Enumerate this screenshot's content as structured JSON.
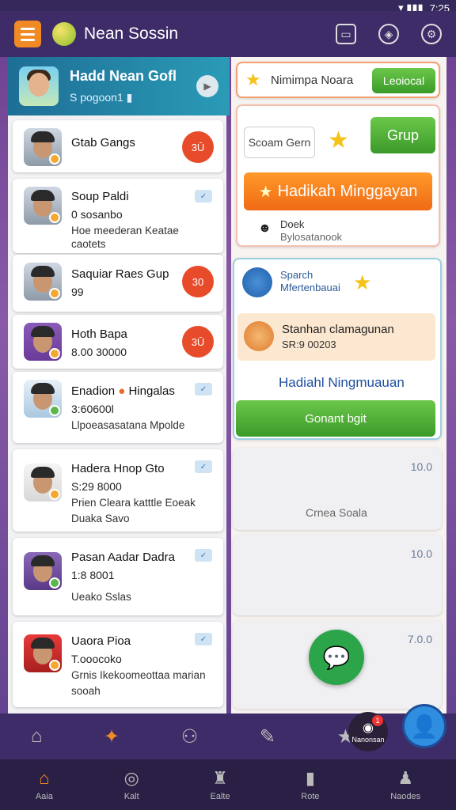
{
  "status": {
    "time": "7:25"
  },
  "header": {
    "title": "Nean Sossin"
  },
  "profile": {
    "name": "Hadd Nean Gofl",
    "sub": "S pogoon1 ▮"
  },
  "list": [
    {
      "title": "Gtab Gangs",
      "badge": "3Ū"
    },
    {
      "title": "Soup Paldi",
      "sub": "0 sosanbo",
      "line1": "Hoe meederan Keatae",
      "line2": "caotets"
    },
    {
      "title": "Saquiar Raes Gup",
      "sub": "99",
      "badge": "30"
    },
    {
      "title": "Hoth Bapa",
      "sub": "8.00 30000",
      "badge": "3Ū"
    },
    {
      "title": "Enadion",
      "title2": "Hingalas",
      "sub": "3:60600l",
      "line1": "Llpoeasasatana Mpolde"
    },
    {
      "title": "Hadera Hnop Gto",
      "sub": "S:29 8000",
      "line1": "Prien Cleara katttle Eoeak",
      "line2": "Duaka Savo"
    },
    {
      "title": "Pasan Aadar Dadra",
      "sub": "1:8 8001",
      "line1": "Ueako Sslas"
    },
    {
      "title": "Uaora Pioa",
      "sub": "T.ooocoko",
      "line1": "Grnis Ikekoomeottaa marian",
      "line2": "sooah"
    }
  ],
  "right": {
    "top_label": "Nimimpa Noara",
    "top_button": "Leoiocal",
    "search_placeholder": "Scoam Gern",
    "group_button": "Grup",
    "orange_button": "Hadikah Minggayan",
    "dock_title": "Doek",
    "dock_sub": "Bylosatanook",
    "search_title": "Sparch",
    "search_sub": "Mfertenbauai",
    "offer_title": "Stanhan clamagunan",
    "offer_sub": "SR:9 00203",
    "link_label": "Hadiahl Ningmuauan",
    "green_button": "Gonant bgit",
    "val1": "10.0",
    "empty_label": "Crnea Soala",
    "val2": "10.0",
    "val3": "7.0.0"
  },
  "nav": [
    {
      "label": "Aaia"
    },
    {
      "label": "Kalt"
    },
    {
      "label": "Ealte"
    },
    {
      "label": "Rote"
    },
    {
      "label": "Naodes"
    }
  ],
  "notif_label": "Nanonsan",
  "notif_count": "1"
}
